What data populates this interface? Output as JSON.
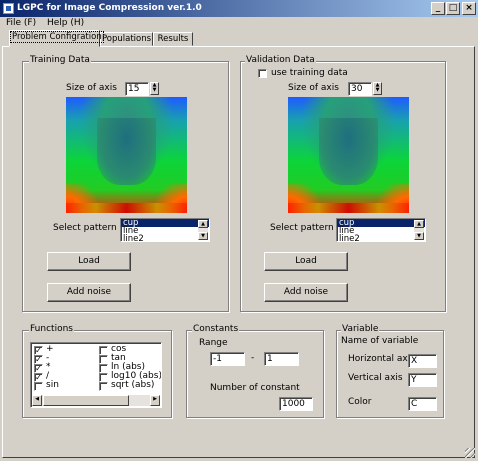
{
  "window": {
    "title": "LGPC for Image Compression ver.1.0",
    "buttons": {
      "minimize": "_",
      "maximize": "□",
      "close": "×"
    }
  },
  "menu": {
    "file": "File (F)",
    "help": "Help (H)"
  },
  "tabs": [
    "Problem Configration",
    "Populations",
    "Results"
  ],
  "training": {
    "title": "Training Data",
    "size_label": "Size of axis",
    "size_value": "15",
    "pattern_label": "Select pattern",
    "patterns": [
      "cup",
      "line",
      "line2"
    ],
    "selected_pattern": "cup",
    "load": "Load",
    "add_noise": "Add noise"
  },
  "validation": {
    "title": "Validation Data",
    "use_training": "use training data",
    "use_training_checked": false,
    "size_label": "Size of axis",
    "size_value": "30",
    "pattern_label": "Select pattern",
    "patterns": [
      "cup",
      "line",
      "line2"
    ],
    "selected_pattern": "cup",
    "load": "Load",
    "add_noise": "Add noise"
  },
  "functions": {
    "title": "Functions",
    "col1": [
      {
        "name": "+",
        "checked": true
      },
      {
        "name": "-",
        "checked": true
      },
      {
        "name": "*",
        "checked": true
      },
      {
        "name": "/",
        "checked": true
      },
      {
        "name": "sin",
        "checked": false
      }
    ],
    "col2": [
      {
        "name": "cos",
        "checked": false
      },
      {
        "name": "tan",
        "checked": false
      },
      {
        "name": "ln (abs)",
        "checked": false
      },
      {
        "name": "log10 (abs)",
        "checked": false
      },
      {
        "name": "sqrt (abs)",
        "checked": false
      }
    ]
  },
  "constants": {
    "title": "Constants",
    "range_label": "Range",
    "range_min": "-1",
    "dash": "-",
    "range_max": "1",
    "number_label": "Number of constant",
    "number_value": "1000"
  },
  "variable": {
    "title": "Variable",
    "name_label": "Name of variable",
    "horizontal_label": "Horizontal axis",
    "horizontal_value": "X",
    "vertical_label": "Vertical axis",
    "vertical_value": "Y",
    "color_label": "Color",
    "color_value": "C"
  },
  "colors": {
    "titlebar": "#0a246a",
    "selection": "#0a246a",
    "face": "#d4d0c8"
  }
}
